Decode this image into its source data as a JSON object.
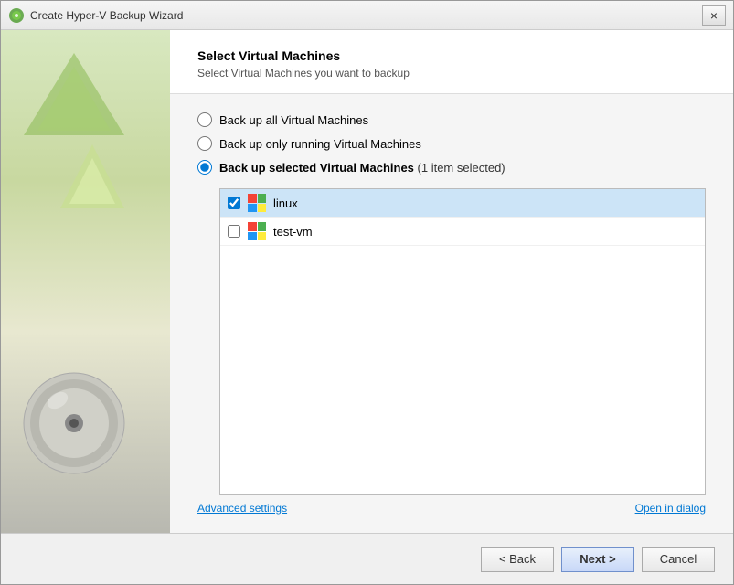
{
  "window": {
    "title": "Create Hyper-V Backup Wizard",
    "close_label": "×"
  },
  "page": {
    "title": "Select Virtual Machines",
    "subtitle": "Select Virtual Machines you want to backup"
  },
  "options": {
    "radio1_label": "Back up all Virtual Machines",
    "radio2_label": "Back up only running Virtual Machines",
    "radio3_label": "Back up selected Virtual Machines",
    "radio3_count": "(1 item selected)"
  },
  "vm_list": [
    {
      "name": "linux",
      "checked": true
    },
    {
      "name": "test-vm",
      "checked": false
    }
  ],
  "links": {
    "advanced_settings": "Advanced settings",
    "open_in_dialog": "Open in dialog"
  },
  "buttons": {
    "back": "< Back",
    "next": "Next >",
    "cancel": "Cancel"
  },
  "colors": {
    "accent": "#0078d4",
    "win_red": "#f44336",
    "win_green": "#4caf50",
    "win_blue": "#2196f3",
    "win_yellow": "#ffeb3b"
  }
}
